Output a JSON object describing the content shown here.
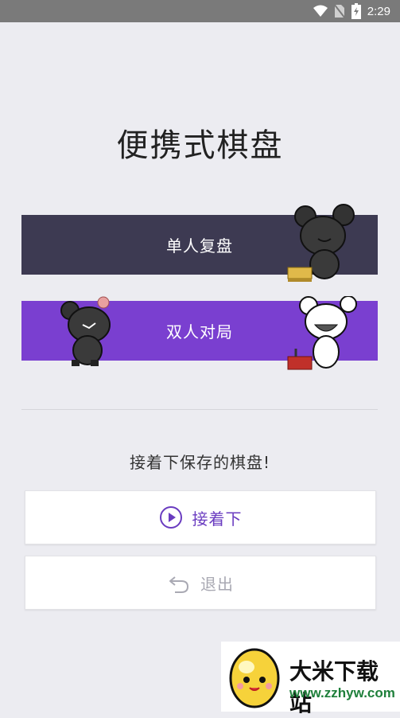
{
  "status_bar": {
    "time": "2:29",
    "icons": [
      "wifi-icon",
      "no-sim-icon",
      "battery-icon"
    ]
  },
  "app": {
    "title": "便携式棋盘"
  },
  "modes": {
    "single_label": "单人复盘",
    "double_label": "双人对局",
    "single_color": "#3d3a52",
    "double_color": "#7a3fd0"
  },
  "resume": {
    "prompt": "接着下保存的棋盘!",
    "continue_label": "接着下",
    "exit_label": "退出",
    "continue_icon": "play-circle-icon",
    "exit_icon": "undo-arrow-icon"
  },
  "watermark": {
    "title": "大米下载站",
    "url": "www.zzhyw.com"
  }
}
